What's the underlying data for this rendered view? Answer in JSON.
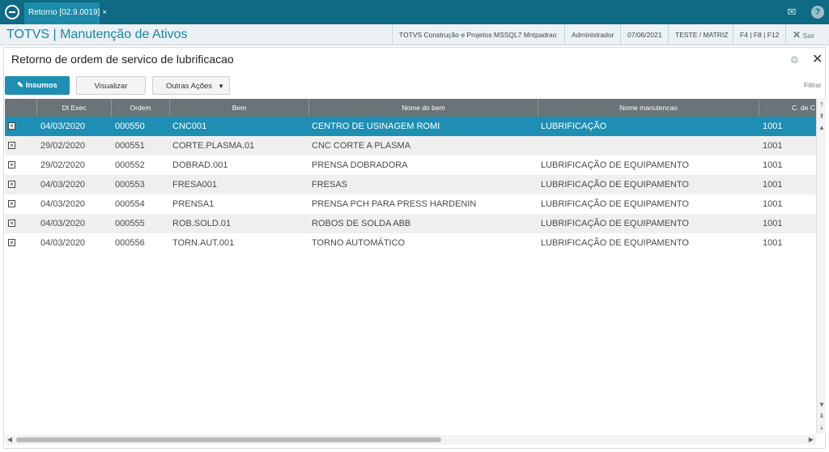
{
  "topbar": {
    "tab_label": "Retorno [02.9.0019]",
    "tab_close": "×",
    "mail_icon": "mail-icon",
    "help_icon": "?"
  },
  "header": {
    "app_title": "TOTVS | Manutenção de Ativos",
    "company": "TOTVS Construção e Projetos MSSQL7 Mntpadrao",
    "user": "Administrador",
    "date": "07/06/2021",
    "branch": "TESTE / MATRIZ",
    "shortcuts": "F4 | F8 | F12",
    "exit_label": "Sair"
  },
  "page": {
    "title": "Retorno de ordem de servico de lubrificacao"
  },
  "toolbar": {
    "insumos_label": "Insumos",
    "visualizar_label": "Visualizar",
    "outras_label": "Outras Ações",
    "filter_label": "Filtrar"
  },
  "grid": {
    "columns": [
      "",
      "Dt Exec",
      "Ordem",
      "Bem",
      "Nome do bem",
      "Nome manutencao",
      "C. de C"
    ],
    "rows": [
      {
        "dt": "04/03/2020",
        "ordem": "000550",
        "bem": "CNC001",
        "nome": "CENTRO DE USINAGEM ROMI",
        "manut": "LUBRIFICAÇÃO",
        "cc": "1001",
        "selected": true
      },
      {
        "dt": "29/02/2020",
        "ordem": "000551",
        "bem": "CORTE.PLASMA.01",
        "nome": "CNC CORTE A PLASMA",
        "manut": "",
        "cc": "1001",
        "selected": false
      },
      {
        "dt": "29/02/2020",
        "ordem": "000552",
        "bem": "DOBRAD.001",
        "nome": "PRENSA DOBRADORA",
        "manut": "LUBRIFICAÇÃO DE EQUIPAMENTO",
        "cc": "1001",
        "selected": false
      },
      {
        "dt": "04/03/2020",
        "ordem": "000553",
        "bem": "FRESA001",
        "nome": "FRESAS",
        "manut": "LUBRIFICAÇÃO DE EQUIPAMENTO",
        "cc": "1001",
        "selected": false
      },
      {
        "dt": "04/03/2020",
        "ordem": "000554",
        "bem": "PRENSA1",
        "nome": "PRENSA PCH PARA PRESS HARDENIN",
        "manut": "LUBRIFICAÇÃO DE EQUIPAMENTO",
        "cc": "1001",
        "selected": false
      },
      {
        "dt": "04/03/2020",
        "ordem": "000555",
        "bem": "ROB.SOLD.01",
        "nome": "ROBOS DE SOLDA ABB",
        "manut": "LUBRIFICAÇÃO DE EQUIPAMENTO",
        "cc": "1001",
        "selected": false
      },
      {
        "dt": "04/03/2020",
        "ordem": "000556",
        "bem": "TORN.AUT.001",
        "nome": "TORNO AUTOMÁTICO",
        "manut": "LUBRIFICAÇÃO DE EQUIPAMENTO",
        "cc": "1001",
        "selected": false
      }
    ]
  },
  "colors": {
    "topbar": "#0f6a84",
    "accent": "#1e8fb3",
    "header_grid": "#6a7378"
  }
}
